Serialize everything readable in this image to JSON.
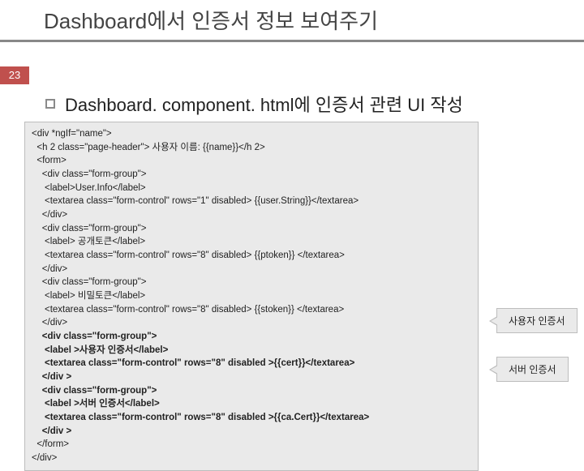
{
  "title": "Dashboard에서 인증서 정보 보여주기",
  "slide_number": "23",
  "bullet_text": "Dashboard. component. html에 인증서 관련 UI 작성",
  "callouts": {
    "user_cert": "사용자 인증서",
    "server_cert": "서버 인증서"
  },
  "code": {
    "l01": "<div *ngIf=\"name\">",
    "l02": "  <h 2 class=\"page-header\"> 사용자 이름: {{name}}</h 2>",
    "l03": "  <form>",
    "l04": "    <div class=\"form-group\">",
    "l05": "     <label>User.Info</label>",
    "l06": "     <textarea class=\"form-control\" rows=\"1\" disabled> {{user.String}}</textarea>",
    "l07": "    </div>",
    "l08": "    <div class=\"form-group\">",
    "l09": "     <label> 공개토큰</label>",
    "l10": "     <textarea class=\"form-control\" rows=\"8\" disabled> {{ptoken}} </textarea>",
    "l11": "    </div>",
    "l12": "    <div class=\"form-group\">",
    "l13": "     <label> 비밀토큰</label>",
    "l14": "     <textarea class=\"form-control\" rows=\"8\" disabled> {{stoken}} </textarea>",
    "l15": "    </div>",
    "l16": "    <div class=\"form-group\">",
    "l17": "     <label >사용자 인증서</label>",
    "l18": "     <textarea class=\"form-control\" rows=\"8\" disabled >{{cert}}</textarea>",
    "l19": "    </div >",
    "l20": "    <div class=\"form-group\">",
    "l21": "     <label >서버 인증서</label>",
    "l22": "     <textarea class=\"form-control\" rows=\"8\" disabled >{{ca.Cert}}</textarea>",
    "l23": "    </div >",
    "l24": "  </form>",
    "l25": "</div>"
  }
}
